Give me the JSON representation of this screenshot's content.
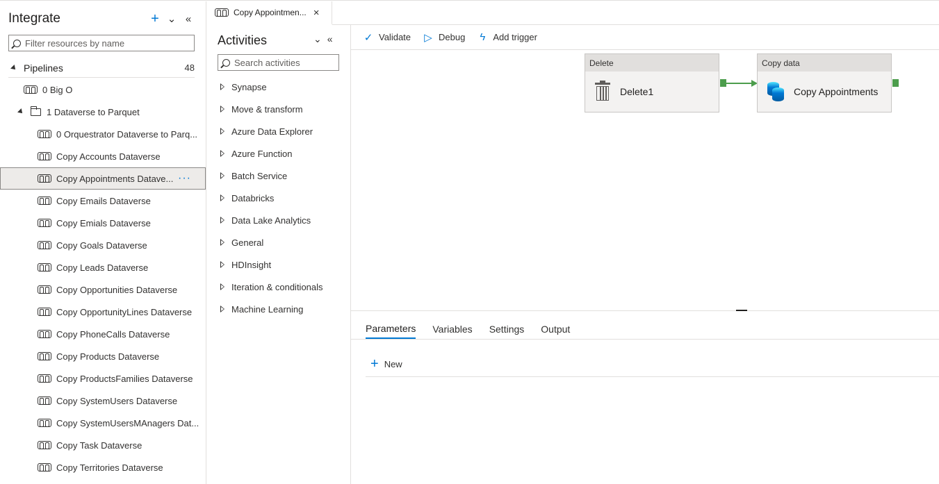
{
  "sidebar": {
    "title": "Integrate",
    "filter_placeholder": "Filter resources by name",
    "pipelines_label": "Pipelines",
    "pipelines_count": "48",
    "items": [
      {
        "label": "0 Big O"
      },
      {
        "label": "1 Dataverse to Parquet"
      },
      {
        "label": "0 Orquestrator Dataverse to Parq..."
      },
      {
        "label": "Copy Accounts Dataverse"
      },
      {
        "label": "Copy Appointments Datave..."
      },
      {
        "label": "Copy Emails Dataverse"
      },
      {
        "label": "Copy Emials Dataverse"
      },
      {
        "label": "Copy Goals Dataverse"
      },
      {
        "label": "Copy Leads Dataverse"
      },
      {
        "label": "Copy Opportunities Dataverse"
      },
      {
        "label": "Copy OpportunityLines Dataverse"
      },
      {
        "label": "Copy PhoneCalls Dataverse"
      },
      {
        "label": "Copy Products Dataverse"
      },
      {
        "label": "Copy ProductsFamilies Dataverse"
      },
      {
        "label": "Copy SystemUsers Dataverse"
      },
      {
        "label": "Copy SystemUsersMAnagers Dat..."
      },
      {
        "label": "Copy Task Dataverse"
      },
      {
        "label": "Copy Territories Dataverse"
      }
    ],
    "more": "···"
  },
  "tab": {
    "label": "Copy Appointmen...",
    "close": "×"
  },
  "activities": {
    "title": "Activities",
    "search_placeholder": "Search activities",
    "items": [
      {
        "label": "Synapse"
      },
      {
        "label": "Move & transform"
      },
      {
        "label": "Azure Data Explorer"
      },
      {
        "label": "Azure Function"
      },
      {
        "label": "Batch Service"
      },
      {
        "label": "Databricks"
      },
      {
        "label": "Data Lake Analytics"
      },
      {
        "label": "General"
      },
      {
        "label": "HDInsight"
      },
      {
        "label": "Iteration & conditionals"
      },
      {
        "label": "Machine Learning"
      }
    ]
  },
  "toolbar": {
    "validate": "Validate",
    "debug": "Debug",
    "add_trigger": "Add trigger"
  },
  "canvas": {
    "nodes": [
      {
        "type_label": "Delete",
        "name": "Delete1",
        "icon": "trash-icon"
      },
      {
        "type_label": "Copy data",
        "name": "Copy Appointments",
        "icon": "database-icon"
      }
    ],
    "connector_color": "#4c9d4c"
  },
  "bottom": {
    "tabs": [
      {
        "label": "Parameters"
      },
      {
        "label": "Variables"
      },
      {
        "label": "Settings"
      },
      {
        "label": "Output"
      }
    ],
    "new_label": "New"
  },
  "colors": {
    "accent": "#0078d4",
    "selected_bg": "#edebe9",
    "success": "#4c9d4c"
  }
}
